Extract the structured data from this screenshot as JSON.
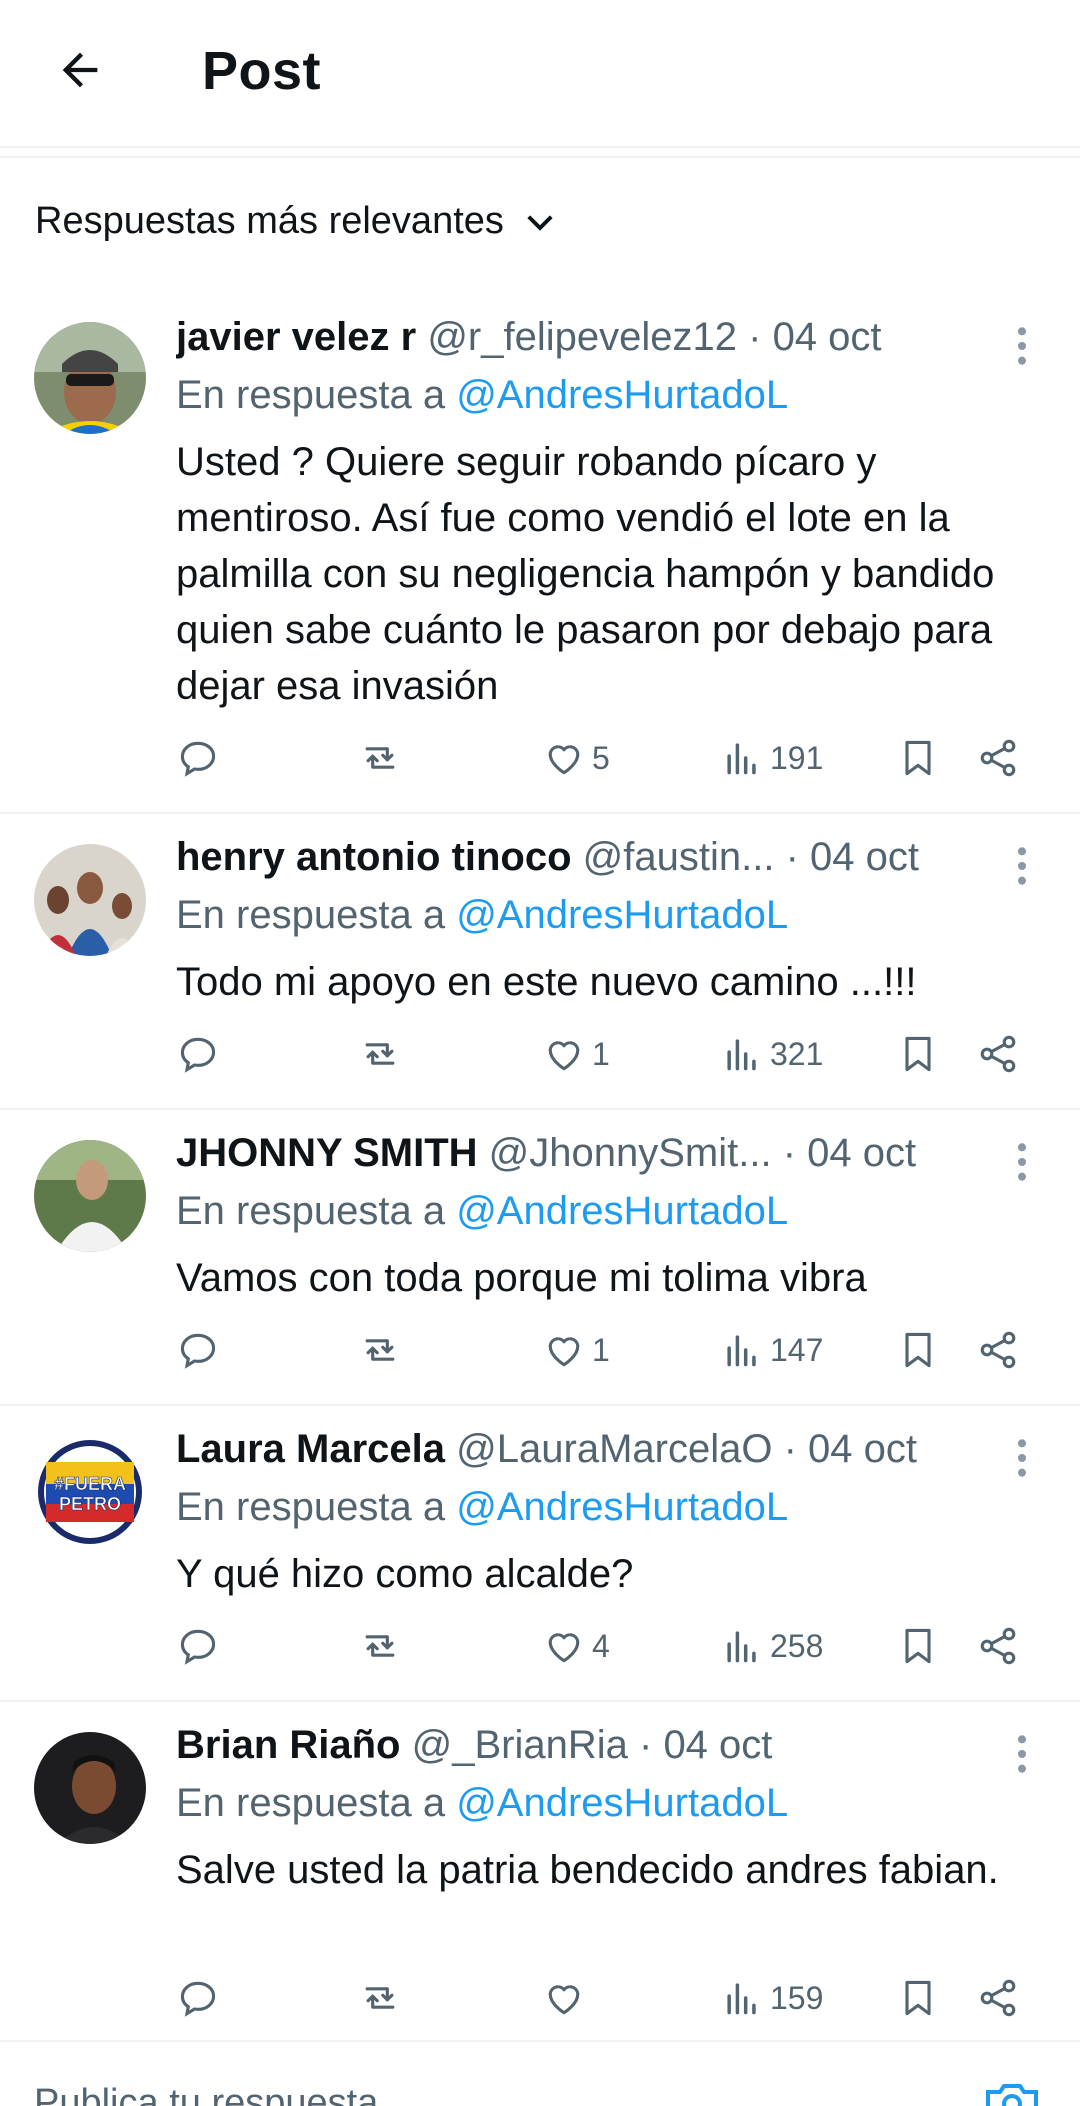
{
  "header": {
    "title": "Post"
  },
  "sort": {
    "label": "Respuestas más relevantes"
  },
  "replies": [
    {
      "name": "javier velez r",
      "handle": "@r_felipevelez12",
      "dot": "·",
      "date": "04 oct",
      "in_reply_label": "En respuesta a",
      "in_reply_to": "@AndresHurtadoL",
      "text": "Usted ? Quiere seguir robando pícaro y mentiroso. Así fue como vendió el lote en la palmilla con su negligencia hampón y bandido quien sabe cuánto le pasaron por debajo para dejar esa invasión",
      "likes": "5",
      "views": "191"
    },
    {
      "name": "henry antonio tinoco",
      "handle": "@faustin...",
      "dot": "·",
      "date": "04 oct",
      "in_reply_label": "En respuesta a",
      "in_reply_to": "@AndresHurtadoL",
      "text": "Todo mi apoyo en este nuevo camino ...!!!",
      "likes": "1",
      "views": "321"
    },
    {
      "name": "JHONNY SMITH",
      "handle": "@JhonnySmit...",
      "dot": "·",
      "date": "04 oct",
      "in_reply_label": "En respuesta a",
      "in_reply_to": "@AndresHurtadoL",
      "text": "Vamos con toda porque mi tolima vibra",
      "likes": "1",
      "views": "147"
    },
    {
      "name": "Laura Marcela",
      "handle": "@LauraMarcelaO",
      "dot": "·",
      "date": "04 oct",
      "in_reply_label": "En respuesta a",
      "in_reply_to": "@AndresHurtadoL",
      "text": "Y qué hizo como alcalde?",
      "likes": "4",
      "views": "258",
      "avatar_text": "#FUERA PETRO"
    },
    {
      "name": "Brian Riaño",
      "handle": "@_BrianRia",
      "dot": "·",
      "date": "04 oct",
      "in_reply_label": "En respuesta a",
      "in_reply_to": "@AndresHurtadoL",
      "text": "Salve usted la patria bendecido andres fabian.",
      "likes": "",
      "views": "159"
    }
  ],
  "composer": {
    "placeholder": "Publica tu respuesta"
  },
  "colors": {
    "accent": "#1d9bf0",
    "muted": "#536471",
    "text": "#0f1419",
    "divider": "#eff3f4"
  },
  "icons": [
    "back-arrow-icon",
    "chevron-down-icon",
    "more-icon",
    "reply-icon",
    "repost-icon",
    "like-icon",
    "views-icon",
    "bookmark-icon",
    "share-icon",
    "camera-icon"
  ]
}
